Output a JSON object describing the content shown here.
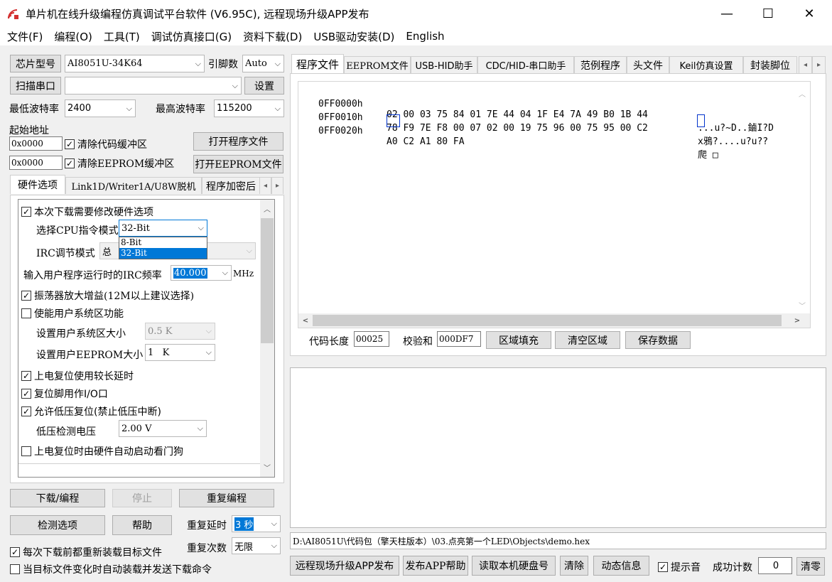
{
  "window": {
    "title": "单片机在线升级编程仿真调试平台软件 (V6.95C), 远程现场升级APP发布",
    "minimize_glyph": "—",
    "maximize_glyph": "☐",
    "close_glyph": "✕"
  },
  "menu": [
    "文件(F)",
    "编程(O)",
    "工具(T)",
    "调试仿真接口(G)",
    "资料下载(D)",
    "USB驱动安装(D)",
    "English"
  ],
  "left": {
    "chip_type_btn": "芯片型号",
    "chip_type_value": "AI8051U-34K64",
    "pin_count_label": "引脚数",
    "pin_count_value": "Auto",
    "scan_port_btn": "扫描串口",
    "port_value": "",
    "settings_btn": "设置",
    "min_baud_label": "最低波特率",
    "min_baud_value": "2400",
    "max_baud_label": "最高波特率",
    "max_baud_value": "115200",
    "start_addr_label": "起始地址",
    "code_addr_value": "0x0000",
    "clear_code_buf_label": "清除代码缓冲区",
    "open_program_btn": "打开程序文件",
    "eeprom_addr_value": "0x0000",
    "clear_eeprom_buf_label": "清除EEPROM缓冲区",
    "open_eeprom_btn": "打开EEPROM文件"
  },
  "left_tabs": [
    "硬件选项",
    "Link1D/Writer1A/U8W脱机",
    "程序加密后"
  ],
  "hw": {
    "modify_hw_label": "本次下载需要修改硬件选项",
    "cpu_mode_label": "选择CPU指令模式",
    "cpu_mode_value": "32-Bit",
    "cpu_mode_options": [
      "8-Bit",
      "32-Bit"
    ],
    "irc_mode_label": "IRC调节模式",
    "irc_mode_value": "总",
    "irc_freq_label": "输入用户程序运行时的IRC频率",
    "irc_freq_value": "40.000",
    "irc_freq_unit": "MHz",
    "osc_gain_label": "振荡器放大增益(12M以上建议选择)",
    "user_sys_label": "使能用户系统区功能",
    "sys_size_label": "设置用户系统区大小",
    "sys_size_value": "0.5 K",
    "eeprom_size_label": "设置用户EEPROM大小",
    "eeprom_size_value": "1   K",
    "long_delay_label": "上电复位使用较长延时",
    "reset_io_label": "复位脚用作I/O口",
    "low_volt_reset_label": "允许低压复位(禁止低压中断)",
    "low_volt_label": "低压检测电压",
    "low_volt_value": "2.00 V",
    "watchdog_label": "上电复位时由硬件自动启动看门狗"
  },
  "bottom_left": {
    "download_btn": "下载/编程",
    "stop_btn": "停止",
    "reprogram_btn": "重复编程",
    "detect_btn": "检测选项",
    "help_btn": "帮助",
    "repeat_delay_label": "重复延时",
    "repeat_delay_value": "3 秒",
    "repeat_count_label": "重复次数",
    "repeat_count_value": "无限",
    "reload_label": "每次下载前都重新装载目标文件",
    "auto_reload_label": "当目标文件变化时自动装载并发送下载命令"
  },
  "right_tabs": [
    "程序文件",
    "EEPROM文件",
    "USB-HID助手",
    "CDC/HID-串口助手",
    "范例程序",
    "头文件",
    "Keil仿真设置",
    "封装脚位"
  ],
  "hex": {
    "lines": [
      {
        "addr": "0FF0000h",
        "bytes": "02 00 03 75 84 01 7E 44 04 1F E4 7A 49 B0 1B 44",
        "ascii": "...u?~D..鏀I?D"
      },
      {
        "addr": "0FF0010h",
        "bytes": "78 F9 7E F8 00 07 02 00 19 75 96 00 75 95 00 C2",
        "ascii": "x鴉?....u?u??"
      },
      {
        "addr": "0FF0020h",
        "bytes": "A0 C2 A1 80 FA",
        "ascii": "爬 □"
      }
    ]
  },
  "hex_footer": {
    "code_len_label": "代码长度",
    "code_len_value": "00025",
    "checksum_label": "校验和",
    "checksum_value": "000DF7",
    "fill_btn": "区域填充",
    "clear_btn": "清空区域",
    "save_btn": "保存数据"
  },
  "file_path": "D:\\AI8051U\\代码包（擎天柱版本）\\03.点亮第一个LED\\Objects\\demo.hex",
  "bottom_right": {
    "publish_btn": "远程现场升级APP发布",
    "publish_help_btn": "发布APP帮助",
    "disk_btn": "读取本机硬盘号",
    "clear_btn": "清除",
    "dynamic_btn": "动态信息",
    "sound_label": "提示音",
    "success_label": "成功计数",
    "success_value": "0",
    "reset_btn": "清零"
  },
  "icons": {
    "check": "✓",
    "dropdown": "⌵",
    "left": "◂",
    "right": "▸",
    "up": "︿",
    "down": "﹀",
    "scroll_left": "<",
    "scroll_right": ">"
  },
  "colors": {
    "app_icon": "#d32f2f",
    "selection": "#0078d7",
    "highlight_box": "#0033cc"
  }
}
